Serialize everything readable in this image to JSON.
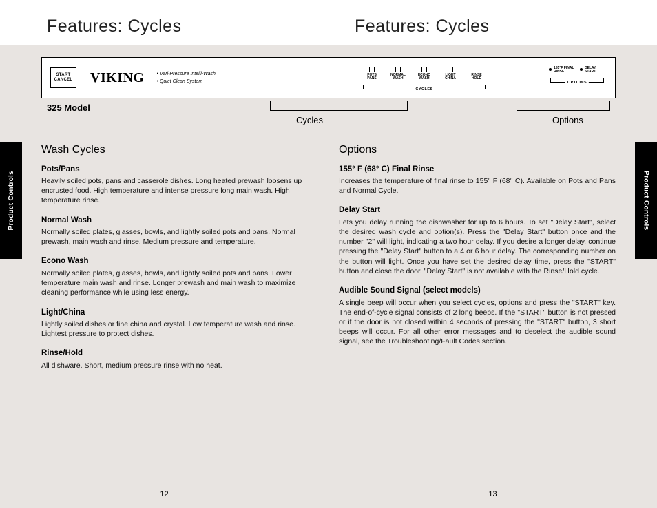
{
  "header": {
    "left": "Features: Cycles",
    "right": "Features: Cycles"
  },
  "side_tab": "Product Controls",
  "panel": {
    "start_line1": "START",
    "start_line2": "CANCEL",
    "brand": "VIKING",
    "feat1": "• Vari-Pressure Intelli-Wash",
    "feat2": "• Quiet Clean System",
    "cycles_group": "CYCLES",
    "options_group": "OPTIONS",
    "cycle_icons": [
      {
        "l1": "POTS",
        "l2": "PANS"
      },
      {
        "l1": "NORMAL",
        "l2": "WASH"
      },
      {
        "l1": "ECONO",
        "l2": "WASH"
      },
      {
        "l1": "LIGHT",
        "l2": "CHINA"
      },
      {
        "l1": "RINSE",
        "l2": "HOLD"
      }
    ],
    "option_icons": [
      {
        "l1": "155°F FINAL",
        "l2": "RINSE"
      },
      {
        "l1": "DELAY",
        "l2": "START"
      }
    ]
  },
  "model": "325 Model",
  "under": {
    "cycles": "Cycles",
    "options": "Options"
  },
  "left_col": {
    "heading": "Wash Cycles",
    "items": [
      {
        "title": "Pots/Pans",
        "body": "Heavily soiled pots, pans and casserole dishes. Long heated prewash loosens up encrusted food. High temperature and intense pressure long main wash. High temperature rinse."
      },
      {
        "title": "Normal Wash",
        "body": "Normally soiled plates, glasses, bowls, and lightly soiled pots and pans. Normal prewash, main wash and rinse. Medium pressure and temperature."
      },
      {
        "title": "Econo Wash",
        "body": "Normally soiled plates, glasses, bowls, and lightly soiled pots and pans. Lower temperature main wash and rinse. Longer prewash and main wash to maximize cleaning performance while using less energy."
      },
      {
        "title": "Light/China",
        "body": "Lightly soiled dishes or fine china and crystal. Low temperature wash and rinse. Lightest pressure to protect dishes."
      },
      {
        "title": "Rinse/Hold",
        "body": "All dishware. Short, medium pressure rinse with no heat."
      }
    ]
  },
  "right_col": {
    "heading": "Options",
    "items": [
      {
        "title": "155° F (68° C) Final Rinse",
        "body": "Increases the temperature of final rinse to 155° F (68° C). Available on Pots and Pans and Normal Cycle."
      },
      {
        "title": "Delay Start",
        "body": "Lets you delay running the dishwasher for up to 6 hours. To set \"Delay Start\", select the desired wash cycle and option(s). Press the \"Delay Start\" button once and the number \"2\" will light, indicating a two hour delay. If you desire a longer delay, continue pressing the \"Delay Start\" button to a 4 or 6 hour delay. The corresponding number on the button will light. Once you have set the desired delay time, press the \"START\" button and close the door. \"Delay Start\" is not available with the Rinse/Hold cycle."
      },
      {
        "title": "Audible Sound Signal (select models)",
        "body": "A single beep will occur when you select cycles, options and press the \"START\" key. The end-of-cycle signal consists of 2 long beeps. If the \"START\" button is not pressed or if the door is not closed within 4 seconds of pressing the \"START\" button, 3 short beeps will occur. For all other error messages and to deselect the audible sound signal, see the Troubleshooting/Fault Codes section."
      }
    ]
  },
  "pages": {
    "left": "12",
    "right": "13"
  }
}
